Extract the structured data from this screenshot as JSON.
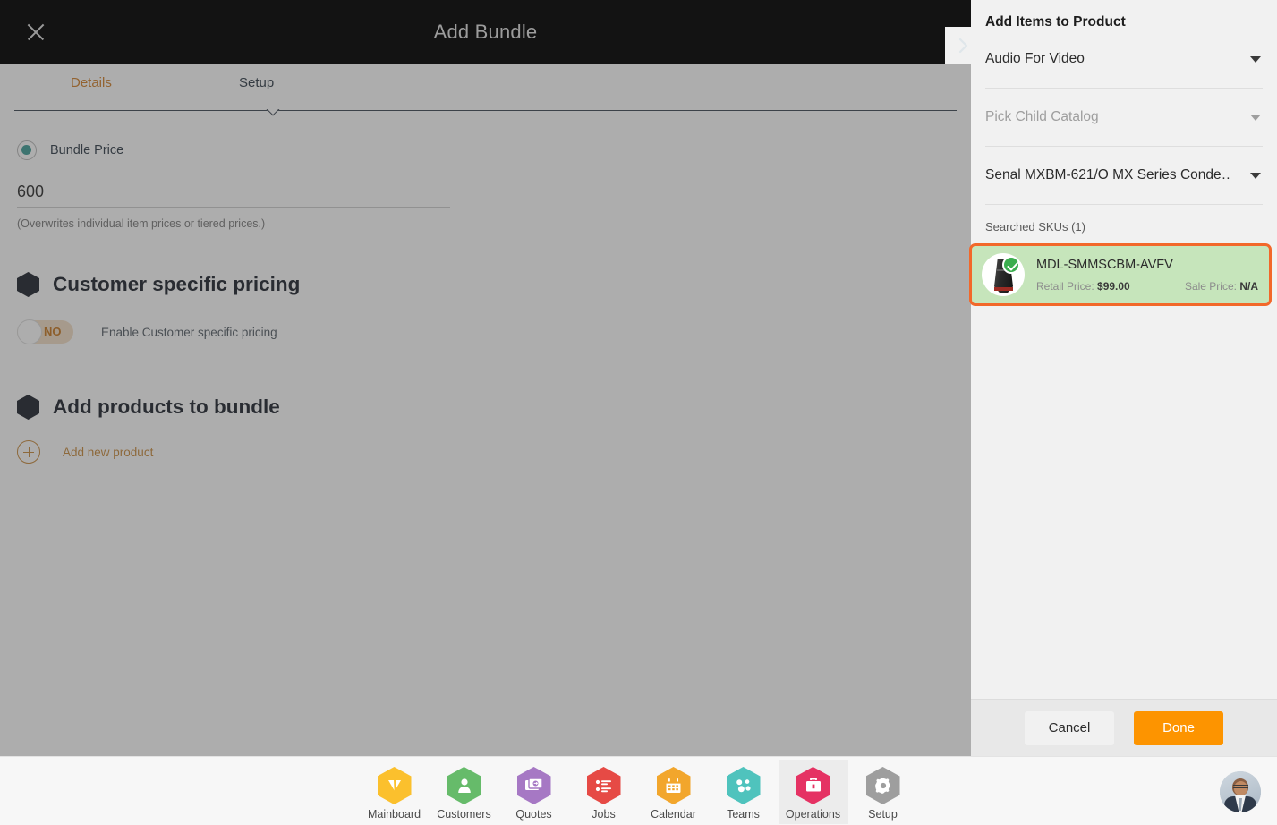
{
  "modal": {
    "title": "Add Bundle",
    "close_icon": "close-icon",
    "next_icon": "chevron-right-icon",
    "tabs": [
      {
        "label": "Details",
        "active": false
      },
      {
        "label": "Setup",
        "active": true
      }
    ],
    "bundle_price": {
      "radio_label": "Bundle Price",
      "value": "600",
      "placeholder": "Bundle Price",
      "hint": "(Overwrites individual item prices or tiered prices.)",
      "accent": "#3f9e96"
    },
    "customer_specific_pricing": {
      "title": "Customer specific pricing",
      "toggle_state": "NO",
      "toggle_text": "Enable Customer specific pricing",
      "accent": "#c8781f"
    },
    "add_products": {
      "title": "Add products to bundle",
      "add_label": "Add new product",
      "add_icon": "plus-circle-icon",
      "accent": "#c98a3c"
    }
  },
  "side_panel": {
    "title": "Add Items to Product",
    "selects": [
      {
        "name": "parent-catalog",
        "value": "Audio For Video",
        "placeholder": "Pick Parent Catalog",
        "is_placeholder": false
      },
      {
        "name": "child-catalog",
        "value": "Pick Child Catalog",
        "placeholder": "Pick Child Catalog",
        "is_placeholder": true
      },
      {
        "name": "product",
        "value": "Senal MXBM-621/O MX Series Conde…",
        "placeholder": "Pick Product",
        "is_placeholder": false
      }
    ],
    "searched_label": "Searched SKUs (1)",
    "skus": [
      {
        "sku": "MDL-SMMSCBM-AVFV",
        "retail_label": "Retail Price:",
        "retail_value": "$99.00",
        "sale_label": "Sale Price:",
        "sale_value": "N/A",
        "selected": true,
        "check_icon": "check-circle-icon",
        "highlight_color": "#f2682a",
        "background_color": "#c6e5bb"
      }
    ],
    "footer": {
      "cancel_label": "Cancel",
      "done_label": "Done",
      "done_color": "#fd9400"
    }
  },
  "bottom_nav": {
    "items": [
      {
        "label": "Mainboard",
        "icon": "mainboard-icon",
        "color": "#fbc02d",
        "active": false
      },
      {
        "label": "Customers",
        "icon": "person-icon",
        "color": "#66bb6a",
        "active": false
      },
      {
        "label": "Quotes",
        "icon": "quotes-icon",
        "color": "#a678c4",
        "active": false
      },
      {
        "label": "Jobs",
        "icon": "list-icon",
        "color": "#e64a45",
        "active": false
      },
      {
        "label": "Calendar",
        "icon": "calendar-icon",
        "color": "#f2a62c",
        "active": false
      },
      {
        "label": "Teams",
        "icon": "teams-icon",
        "color": "#4fc3bd",
        "active": false
      },
      {
        "label": "Operations",
        "icon": "briefcase-icon",
        "color": "#e53263",
        "active": true
      },
      {
        "label": "Setup",
        "icon": "gear-icon",
        "color": "#9e9e9e",
        "active": false
      }
    ],
    "avatar": "user-avatar"
  }
}
